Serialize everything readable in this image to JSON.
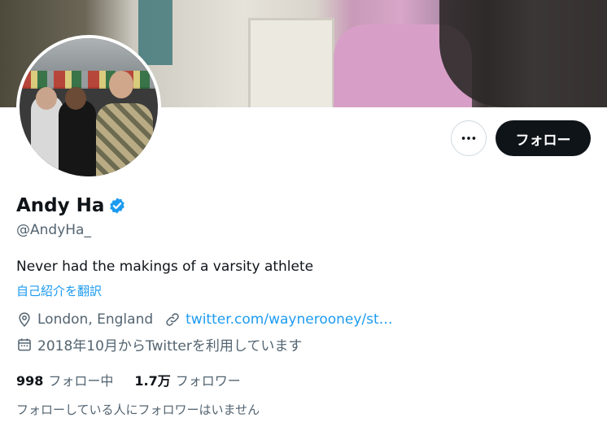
{
  "profile": {
    "name": "Andy Ha",
    "handle": "@AndyHa_",
    "bio": "Never had the makings of a varsity athlete",
    "translate_bio": "自己紹介を翻訳",
    "location": "London, England",
    "website": "twitter.com/waynerooney/st…",
    "joined": "2018年10月からTwitterを利用しています",
    "verified": true
  },
  "actions": {
    "more_icon": "more-horizontal-icon",
    "follow_label": "フォロー"
  },
  "stats": {
    "following_count": "998",
    "following_label": "フォロー中",
    "followers_count": "1.7万",
    "followers_label": "フォロワー"
  },
  "followers_you_know": "フォローしている人にフォロワーはいません",
  "colors": {
    "accent": "#1d9bf0",
    "text": "#0f1419",
    "secondary": "#536471",
    "button_dark": "#0f1419"
  }
}
